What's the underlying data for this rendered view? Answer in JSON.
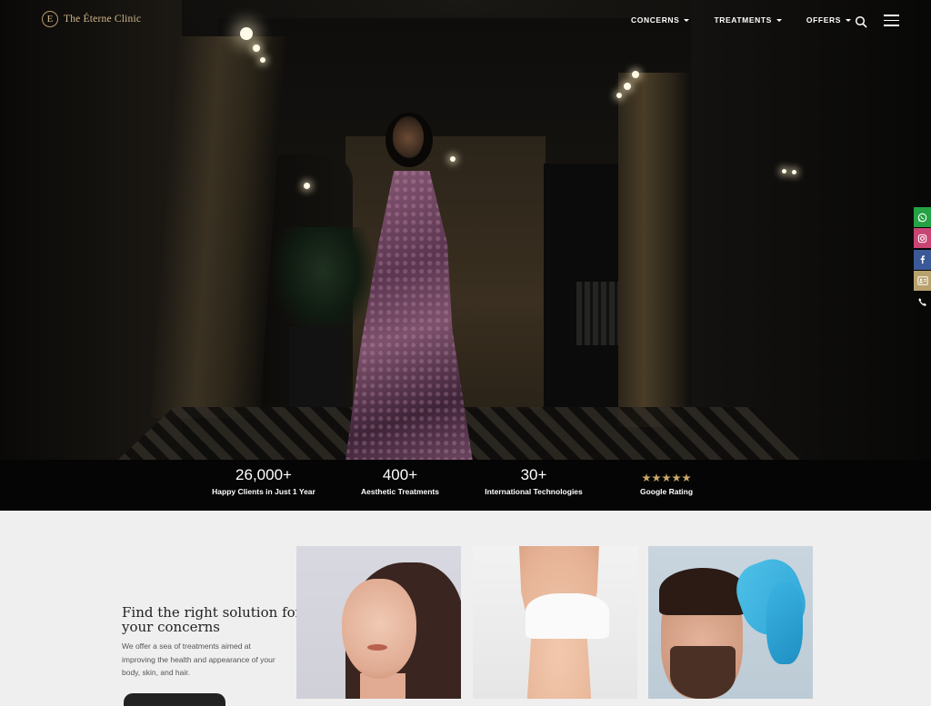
{
  "brand": {
    "logo_letter": "E",
    "name": "The Éterne Clinic"
  },
  "nav": {
    "items": [
      {
        "label": "CONCERNS"
      },
      {
        "label": "TREATMENTS"
      },
      {
        "label": "OFFERS"
      }
    ],
    "search_icon": "search-icon",
    "menu_icon": "hamburger-menu-icon"
  },
  "social": [
    {
      "name": "whatsapp-icon",
      "color": "#25a243"
    },
    {
      "name": "instagram-icon",
      "color": "#c84472"
    },
    {
      "name": "facebook-icon",
      "color": "#3b5998"
    },
    {
      "name": "contact-card-icon",
      "color": "#b9a16d"
    },
    {
      "name": "phone-icon",
      "color": "transparent"
    }
  ],
  "stats": [
    {
      "value": "26,000+",
      "label": "Happy Clients in Just 1 Year"
    },
    {
      "value": "400+",
      "label": "Aesthetic Treatments"
    },
    {
      "value": "30+",
      "label": "International Technologies"
    },
    {
      "value": "",
      "label": "Google Rating",
      "stars": 5
    }
  ],
  "concerns": {
    "title": "Find the right solution for your concerns",
    "description": "We offer a sea of treatments aimed at improving the health and appearance of your body, skin, and hair.",
    "cards": [
      "face-concern-image",
      "body-concern-image",
      "hair-concern-image"
    ]
  },
  "colors": {
    "gold": "#d2b98a",
    "star": "#c9a96a",
    "dark": "#050505"
  }
}
